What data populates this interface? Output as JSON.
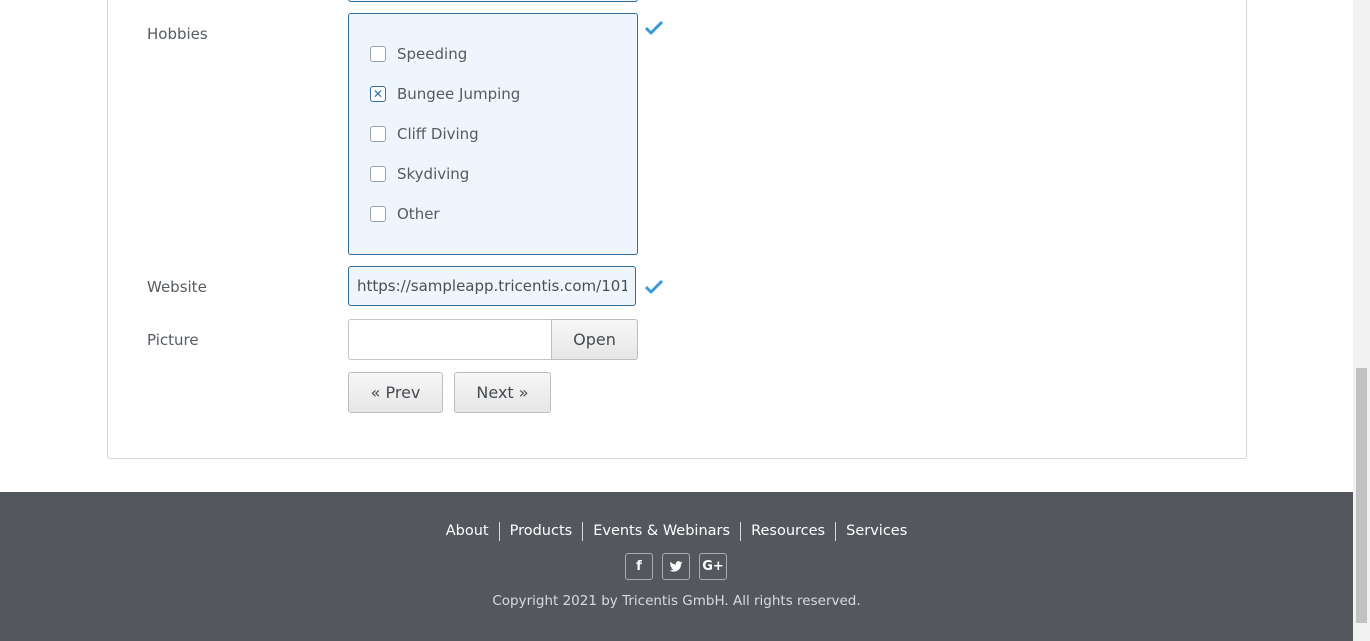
{
  "form": {
    "hobbies_label": "Hobbies",
    "hobbies": [
      {
        "label": "Speeding",
        "checked": false
      },
      {
        "label": "Bungee Jumping",
        "checked": true
      },
      {
        "label": "Cliff Diving",
        "checked": false
      },
      {
        "label": "Skydiving",
        "checked": false
      },
      {
        "label": "Other",
        "checked": false
      }
    ],
    "website_label": "Website",
    "website_value": "https://sampleapp.tricentis.com/101",
    "picture_label": "Picture",
    "open_button": "Open",
    "prev_button": "« Prev",
    "next_button": "Next »"
  },
  "footer": {
    "links": [
      "About",
      "Products",
      "Events & Webinars",
      "Resources",
      "Services"
    ],
    "social": [
      {
        "icon": "facebook-icon",
        "glyph": "f"
      },
      {
        "icon": "twitter-icon",
        "glyph": "t"
      },
      {
        "icon": "google-plus-icon",
        "glyph": "G+"
      }
    ],
    "copyright": "Copyright 2021 by Tricentis GmbH. All rights reserved."
  },
  "colors": {
    "accent": "#336c9e",
    "field_bg": "#eef5fd",
    "check": "#3a9ad9",
    "footer_bg": "#54575d"
  }
}
